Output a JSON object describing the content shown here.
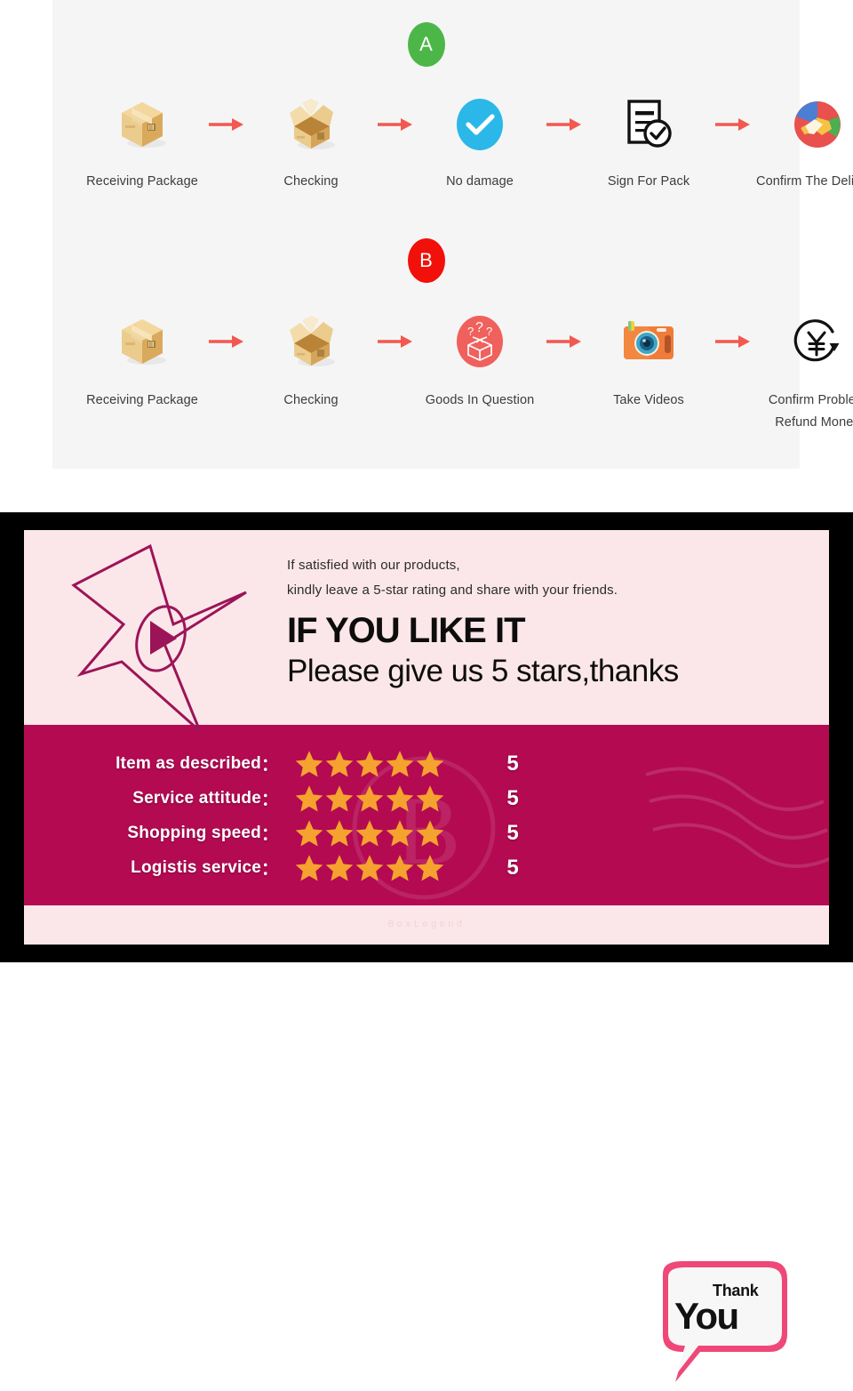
{
  "flow": {
    "section_a": {
      "badge": "A",
      "badge_color": "#4CB748",
      "steps": [
        {
          "label": "Receiving Package",
          "icon": "closed-box-icon"
        },
        {
          "label": "Checking",
          "icon": "open-box-icon"
        },
        {
          "label": "No damage",
          "icon": "blue-check-circle-icon"
        },
        {
          "label": "Sign For Pack",
          "icon": "signed-document-icon"
        },
        {
          "label": "Confirm The Delivery",
          "icon": "handshake-circle-icon"
        }
      ],
      "arrow_label": "arrow-right"
    },
    "section_b": {
      "badge": "B",
      "badge_color": "#F2100A",
      "steps": [
        {
          "label": "Receiving Package",
          "icon": "closed-box-icon"
        },
        {
          "label": "Checking",
          "icon": "open-box-icon"
        },
        {
          "label": "Goods In Question",
          "icon": "question-box-circle-icon"
        },
        {
          "label": "Take Videos",
          "icon": "camera-icon"
        },
        {
          "label": "Confirm Problem\nRefund Money",
          "icon": "yen-refund-icon"
        }
      ],
      "arrow_label": "arrow-right"
    },
    "arrow_color": "#F2584F",
    "panel_bg": "#f5f5f5"
  },
  "feedback": {
    "intro_line_1": "If satisfied with our products,",
    "intro_line_2": "kindly leave a 5-star rating and share with your friends.",
    "headline_big": "IF YOU LIKE IT",
    "headline_sub": "Please give us 5 stars,thanks",
    "ratings": [
      {
        "label": "Item as described",
        "colon": "：",
        "stars": 5,
        "score": "5"
      },
      {
        "label": "Service attitude",
        "colon": "：",
        "stars": 5,
        "score": "5"
      },
      {
        "label": "Shopping speed",
        "colon": "：",
        "stars": 5,
        "score": "5"
      },
      {
        "label": "Logistis service",
        "colon": "：",
        "stars": 5,
        "score": "5"
      }
    ],
    "thank_you": {
      "line_1": "Thank",
      "line_2": "You"
    },
    "watermark": "BoxLegend",
    "colors": {
      "frame": "#000000",
      "card_bg": "#B30A52",
      "strip_bg": "#FBE7E9",
      "star": "#F5A623",
      "star_outline": "#9C1458"
    }
  }
}
